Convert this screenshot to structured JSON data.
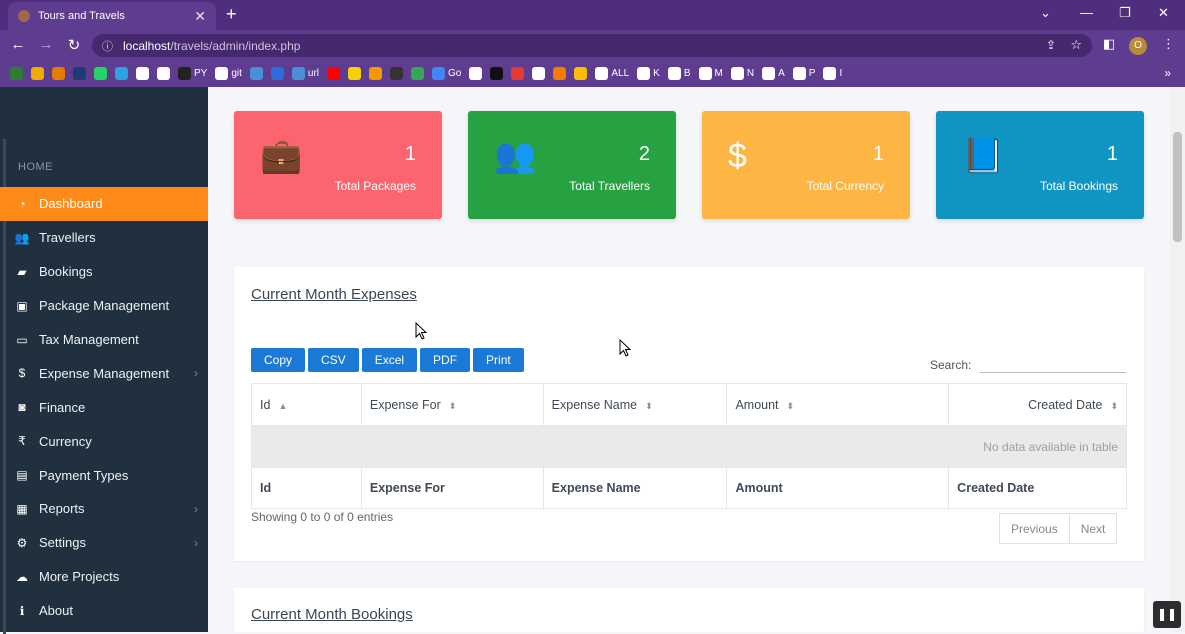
{
  "browser": {
    "tab_title": "Tours and Travels",
    "tab_close": "✕",
    "new_tab": "+",
    "url_host": "localhost",
    "url_path": "/travels/admin/index.php",
    "profile_initial": "O",
    "bookmarks": [
      {
        "label": "",
        "color": "#2e7d32"
      },
      {
        "label": "",
        "color": "#f2a900"
      },
      {
        "label": "",
        "color": "#e57c00"
      },
      {
        "label": "",
        "color": "#1f3b73"
      },
      {
        "label": "",
        "color": "#25d366"
      },
      {
        "label": "",
        "color": "#2aa3df"
      },
      {
        "label": "",
        "color": "#ffffff"
      },
      {
        "label": "",
        "color": "#ffffff"
      },
      {
        "label": "PY",
        "color": "#222222"
      },
      {
        "label": "git",
        "color": "#ffffff"
      },
      {
        "label": "",
        "color": "#4a90d9"
      },
      {
        "label": "",
        "color": "#2d6cdf"
      },
      {
        "label": "url",
        "color": "#4a90d9"
      },
      {
        "label": "",
        "color": "#ff0000"
      },
      {
        "label": "",
        "color": "#f7d000"
      },
      {
        "label": "",
        "color": "#f29900"
      },
      {
        "label": "",
        "color": "#333333"
      },
      {
        "label": "",
        "color": "#34a853"
      },
      {
        "label": "Go",
        "color": "#4285f4"
      },
      {
        "label": "",
        "color": "#ffffff"
      },
      {
        "label": "",
        "color": "#111111"
      },
      {
        "label": "",
        "color": "#e53935"
      },
      {
        "label": "",
        "color": "#ffffff"
      },
      {
        "label": "",
        "color": "#f57c00"
      },
      {
        "label": "",
        "color": "#fbbc05"
      },
      {
        "label": "ALL",
        "color": "#ffffff"
      },
      {
        "label": "K",
        "color": "#ffffff"
      },
      {
        "label": "B",
        "color": "#ffffff"
      },
      {
        "label": "M",
        "color": "#ffffff"
      },
      {
        "label": "N",
        "color": "#ffffff"
      },
      {
        "label": "A",
        "color": "#ffffff"
      },
      {
        "label": "P",
        "color": "#ffffff"
      },
      {
        "label": "I",
        "color": "#ffffff"
      }
    ],
    "bookmarks_more": "»"
  },
  "sidebar": {
    "section_label": "HOME",
    "items": [
      {
        "label": "Dashboard",
        "icon": "dashboard-icon",
        "glyph": "◔",
        "active": true,
        "chevron": ""
      },
      {
        "label": "Travellers",
        "icon": "users-icon",
        "glyph": "👥",
        "active": false,
        "chevron": ""
      },
      {
        "label": "Bookings",
        "icon": "book-icon",
        "glyph": "▰",
        "active": false,
        "chevron": ""
      },
      {
        "label": "Package Management",
        "icon": "briefcase-icon",
        "glyph": "▣",
        "active": false,
        "chevron": ""
      },
      {
        "label": "Tax Management",
        "icon": "credit-card-icon",
        "glyph": "▭",
        "active": false,
        "chevron": ""
      },
      {
        "label": "Expense Management",
        "icon": "dollar-icon",
        "glyph": "$",
        "active": false,
        "chevron": "›"
      },
      {
        "label": "Finance",
        "icon": "money-bill-icon",
        "glyph": "◙",
        "active": false,
        "chevron": ""
      },
      {
        "label": "Currency",
        "icon": "rupee-icon",
        "glyph": "₹",
        "active": false,
        "chevron": ""
      },
      {
        "label": "Payment Types",
        "icon": "payment-icon",
        "glyph": "▤",
        "active": false,
        "chevron": ""
      },
      {
        "label": "Reports",
        "icon": "report-icon",
        "glyph": "▦",
        "active": false,
        "chevron": "›"
      },
      {
        "label": "Settings",
        "icon": "gear-icon",
        "glyph": "⚙",
        "active": false,
        "chevron": "›"
      },
      {
        "label": "More Projects",
        "icon": "cloud-download-icon",
        "glyph": "☁",
        "active": false,
        "chevron": ""
      },
      {
        "label": "About",
        "icon": "info-icon",
        "glyph": "ℹ",
        "active": false,
        "chevron": ""
      }
    ]
  },
  "stats": [
    {
      "value": "1",
      "label": "Total Packages",
      "icon": "suitcase-icon",
      "glyph": "💼",
      "color": "#fc6470"
    },
    {
      "value": "2",
      "label": "Total Travellers",
      "icon": "users-icon",
      "glyph": "👥",
      "color": "#27a243"
    },
    {
      "value": "1",
      "label": "Total Currency",
      "icon": "dollar-icon",
      "glyph": "$",
      "color": "#fdb544"
    },
    {
      "value": "1",
      "label": "Total Bookings",
      "icon": "book-icon",
      "glyph": "📘",
      "color": "#1196c3"
    }
  ],
  "expenses": {
    "title": "Current Month Expenses",
    "buttons": [
      "Copy",
      "CSV",
      "Excel",
      "PDF",
      "Print"
    ],
    "search_label": "Search:",
    "search_value": "",
    "columns": [
      "Id",
      "Expense For",
      "Expense Name",
      "Amount",
      "Created Date"
    ],
    "empty_message": "No data available in table",
    "info": "Showing 0 to 0 of 0 entries",
    "prev": "Previous",
    "next": "Next"
  },
  "bookings": {
    "title": "Current Month Bookings"
  },
  "overlay": {
    "pause": "❚❚"
  }
}
